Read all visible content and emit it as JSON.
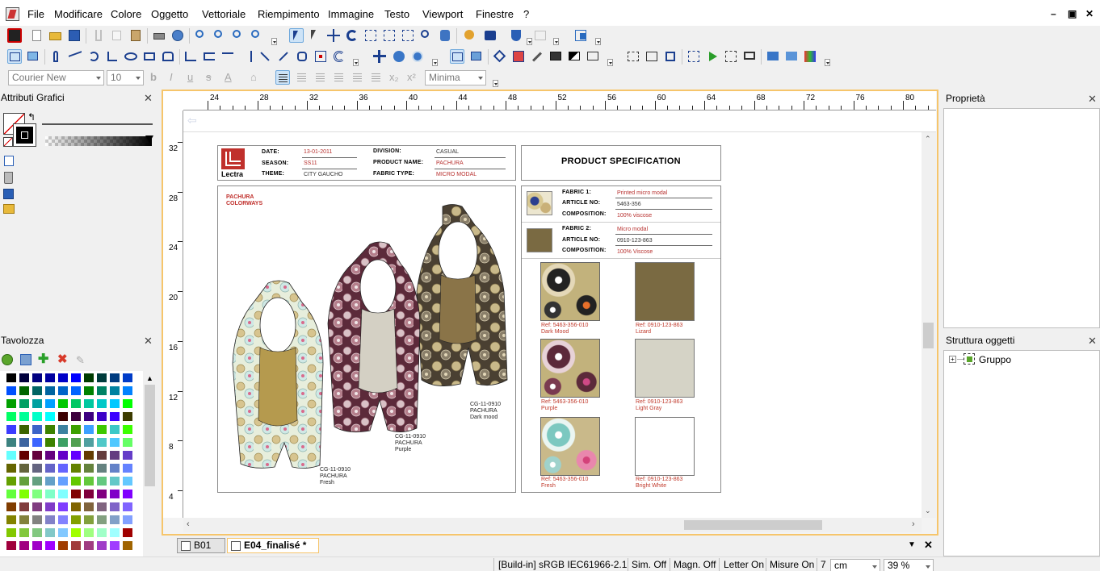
{
  "menu": {
    "items": [
      "File",
      "Modificare",
      "Colore",
      "Oggetto",
      "Vettoriale",
      "Riempimento",
      "Immagine",
      "Testo",
      "Viewport",
      "Finestre",
      "?"
    ]
  },
  "window_controls": {
    "minimize": "–",
    "restore": "▣",
    "close": "✕"
  },
  "format_bar": {
    "font": "Courier New",
    "size": "10",
    "bold": "b",
    "italic": "I",
    "underline": "u",
    "strike": "s",
    "text_color": "A",
    "subscript": "x₂",
    "superscript": "x²",
    "kerning": "Minima"
  },
  "panels": {
    "attributes": {
      "title": "Attributi Grafici"
    },
    "palette": {
      "title": "Tavolozza",
      "colors": [
        "#000000",
        "#00003c",
        "#000080",
        "#0000a0",
        "#0000c8",
        "#0000ff",
        "#003c00",
        "#003c3c",
        "#003c80",
        "#003cc8",
        "#0050ff",
        "#006400",
        "#006464",
        "#0064a0",
        "#0064c8",
        "#0064ff",
        "#008200",
        "#008264",
        "#0082a0",
        "#0082ff",
        "#00a000",
        "#00a064",
        "#00a0a0",
        "#00a0ff",
        "#00c800",
        "#00c864",
        "#00c8a0",
        "#00c8c8",
        "#00c8ff",
        "#00ff00",
        "#00ff64",
        "#00ff96",
        "#00ffc8",
        "#00ffff",
        "#3c0000",
        "#3c003c",
        "#3c0080",
        "#3c00c8",
        "#3c00ff",
        "#3c3c00",
        "#3c3cff",
        "#3c6400",
        "#3c64c8",
        "#3c8200",
        "#3c82a0",
        "#3ca000",
        "#3ca0ff",
        "#3cc800",
        "#3cc8c8",
        "#3cff00",
        "#3c8280",
        "#3c64a0",
        "#3c64ff",
        "#3c8200",
        "#3ca064",
        "#50a050",
        "#50a0a0",
        "#50c8c8",
        "#50c8ff",
        "#64ff64",
        "#64ffff",
        "#640000",
        "#64003c",
        "#640080",
        "#6400c8",
        "#6400ff",
        "#643c00",
        "#643c3c",
        "#643c80",
        "#643cc8",
        "#646400",
        "#64643c",
        "#646480",
        "#6464c8",
        "#6464ff",
        "#648200",
        "#64823c",
        "#648280",
        "#6482c8",
        "#6482ff",
        "#64a000",
        "#64a03c",
        "#64a080",
        "#64a0c8",
        "#64a0ff",
        "#64c800",
        "#64c83c",
        "#64c880",
        "#64c8c8",
        "#64c8ff",
        "#64ff3c",
        "#80ff00",
        "#80ff80",
        "#80ffc8",
        "#80ffff",
        "#800000",
        "#80003c",
        "#800080",
        "#8000c8",
        "#8000ff",
        "#803c00",
        "#803c3c",
        "#803c80",
        "#803cc8",
        "#803cff",
        "#806400",
        "#80643c",
        "#806480",
        "#8064c8",
        "#8064ff",
        "#828200",
        "#82823c",
        "#828280",
        "#8282c8",
        "#8282ff",
        "#82a000",
        "#82a03c",
        "#82a080",
        "#82a0c8",
        "#82a0ff",
        "#82c800",
        "#82c83c",
        "#82c880",
        "#82c8c8",
        "#82c8ff",
        "#a0ff00",
        "#a0ff80",
        "#a0ffc8",
        "#a0ffff",
        "#a00000",
        "#a0003c",
        "#a00080",
        "#a000c8",
        "#a000ff",
        "#a03c00",
        "#a03c3c",
        "#a03c80",
        "#a03cc8",
        "#a03cff",
        "#a06400"
      ]
    },
    "properties": {
      "title": "Proprietà"
    },
    "structure": {
      "title": "Struttura oggetti",
      "root": "Gruppo"
    }
  },
  "ruler": {
    "h": [
      "24",
      "28",
      "32",
      "36",
      "40",
      "44",
      "48",
      "52",
      "56",
      "60",
      "64",
      "68",
      "72",
      "76",
      "80"
    ],
    "v": [
      "32",
      "28",
      "24",
      "20",
      "16",
      "12",
      "8",
      "4"
    ]
  },
  "sheet": {
    "brand": "Lectra",
    "header": {
      "date_label": "DATE:",
      "date": "13-01-2011",
      "season_label": "SEASON:",
      "season": "SS11",
      "theme_label": "THEME:",
      "theme": "CITY GAUCHO",
      "division_label": "DIVISION:",
      "division": "CASUAL",
      "product_label": "PRODUCT NAME:",
      "product": "PACHURA",
      "fabric_type_label": "FABRIC TYPE:",
      "fabric_type": "MICRO MODAL"
    },
    "spec_title": "PRODUCT SPECIFICATION",
    "colorways_title_1": "PACHURA",
    "colorways_title_2": "COLORWAYS",
    "garments": [
      {
        "code": "CG-11-0910",
        "name": "PACHURA",
        "color": "Fresh"
      },
      {
        "code": "CG-11-0910",
        "name": "PACHURA",
        "color": "Purple"
      },
      {
        "code": "CG-11-0910",
        "name": "PACHURA",
        "color": "Dark mood"
      }
    ],
    "fabric1": {
      "label": "FABRIC 1:",
      "value": "Printed micro modal",
      "art_label": "ARTICLE NO:",
      "art": "5463-356",
      "comp_label": "COMPOSITION:",
      "comp": "100% viscose"
    },
    "fabric2": {
      "label": "FABRIC 2:",
      "value": "Micro modal",
      "art_label": "ARTICLE NO:",
      "art": "0910-123-863",
      "comp_label": "COMPOSITION:",
      "comp": "100% Viscose"
    },
    "swatches": [
      {
        "ref": "Ref: 5463-356-010",
        "name": "Dark Mood",
        "color": "#3a3326"
      },
      {
        "ref": "Ref: 0910-123-863",
        "name": "Lizard",
        "color": "#7a6a42"
      },
      {
        "ref": "Ref: 5463-356-010",
        "name": "Purple",
        "color": "#5c2a3a"
      },
      {
        "ref": "Ref: 0910-123-863",
        "name": "Light Gray",
        "color": "#d5d3c6"
      },
      {
        "ref": "Ref: 5463-356-010",
        "name": "Fresh",
        "color": "#cfe6df"
      },
      {
        "ref": "Ref: 0910-123-863",
        "name": "Bright White",
        "color": "#ffffff"
      }
    ]
  },
  "tabs": [
    {
      "label": "B01"
    },
    {
      "label": "E04_finalisé *"
    }
  ],
  "status": {
    "profile": "[Build-in] sRGB IEC61966-2.1",
    "sim": "Sim. Off",
    "magn": "Magn. Off",
    "letter": "Letter On",
    "measure": "Misure On",
    "measure_count": "7",
    "unit": "cm",
    "zoom": "39 %"
  }
}
